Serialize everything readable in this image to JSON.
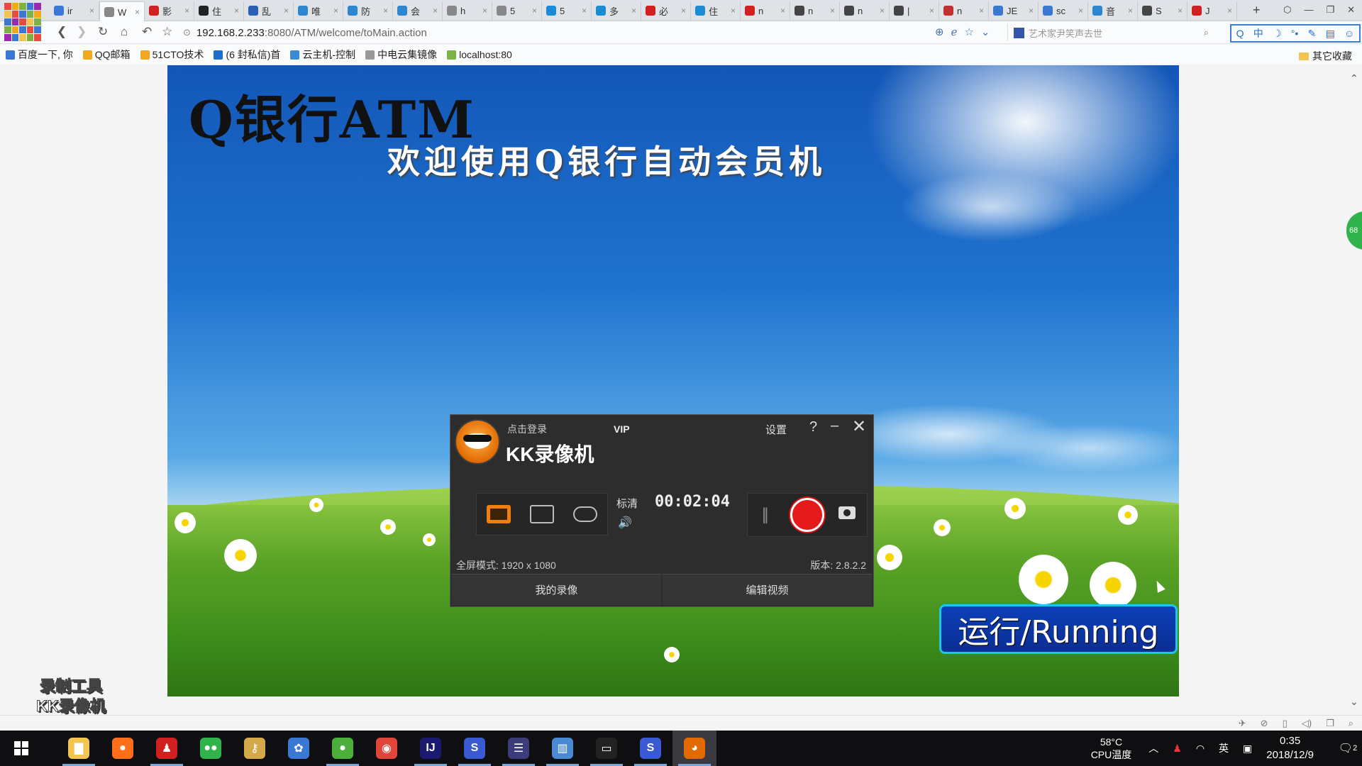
{
  "browser": {
    "tabs": [
      {
        "label": "ir",
        "icon_color": "#3a78d4",
        "active": false
      },
      {
        "label": "W",
        "icon_color": "#888888",
        "active": true
      },
      {
        "label": "影",
        "icon_color": "#d02020",
        "active": false
      },
      {
        "label": "住",
        "icon_color": "#222222",
        "active": false
      },
      {
        "label": "乱",
        "icon_color": "#2b5fb5",
        "active": false
      },
      {
        "label": "唯",
        "icon_color": "#2f86d0",
        "active": false
      },
      {
        "label": "防",
        "icon_color": "#2f86d0",
        "active": false
      },
      {
        "label": "会",
        "icon_color": "#2f86d0",
        "active": false
      },
      {
        "label": "h",
        "icon_color": "#888888",
        "active": false
      },
      {
        "label": "5",
        "icon_color": "#888888",
        "active": false
      },
      {
        "label": "5",
        "icon_color": "#1c8bd6",
        "active": false
      },
      {
        "label": "多",
        "icon_color": "#1c8bd6",
        "active": false
      },
      {
        "label": "必",
        "icon_color": "#d02020",
        "active": false
      },
      {
        "label": "住",
        "icon_color": "#1c8bd6",
        "active": false
      },
      {
        "label": "n",
        "icon_color": "#d02020",
        "active": false
      },
      {
        "label": "n",
        "icon_color": "#444444",
        "active": false
      },
      {
        "label": "n",
        "icon_color": "#444444",
        "active": false
      },
      {
        "label": "|",
        "icon_color": "#444444",
        "active": false
      },
      {
        "label": "n",
        "icon_color": "#c03030",
        "active": false
      },
      {
        "label": "JE",
        "icon_color": "#3a78d4",
        "active": false
      },
      {
        "label": "sc",
        "icon_color": "#3a78d4",
        "active": false
      },
      {
        "label": "音",
        "icon_color": "#2f86d0",
        "active": false
      },
      {
        "label": "S",
        "icon_color": "#444444",
        "active": false
      },
      {
        "label": "J",
        "icon_color": "#d02020",
        "active": false
      }
    ],
    "new_tab_label": "+",
    "url_host": "192.168.2.233",
    "url_rest": ":8080/ATM/welcome/toMain.action",
    "search_placeholder": "艺术家尹笑声去世",
    "ext_bar_items": [
      "Q",
      "中",
      "☽",
      "°•",
      "✎",
      "▤",
      "☺"
    ],
    "bookmarks": [
      {
        "label": "百度一下, 你",
        "icon_color": "#3a78d4"
      },
      {
        "label": "QQ邮箱",
        "icon_color": "#f2a81d"
      },
      {
        "label": "51CTO技术",
        "icon_color": "#f2a81d"
      },
      {
        "label": "(6 封私信)首",
        "icon_color": "#1c6fd0"
      },
      {
        "label": "云主机-控制",
        "icon_color": "#3a8ad4"
      },
      {
        "label": "中电云集镜像",
        "icon_color": "#999999"
      },
      {
        "label": "localhost:80",
        "icon_color": "#7cb342"
      }
    ],
    "other_bookmarks": "其它收藏"
  },
  "page": {
    "banner_title": "Q银行ATM",
    "banner_subtitle": "欢迎使用Q银行自动会员机",
    "running_button": "运行/Running",
    "float_ball_text": "68"
  },
  "watermark": {
    "line1": "录制工具",
    "line2": "KK录像机"
  },
  "kk_recorder": {
    "login_text": "点击登录",
    "vip_text": "VIP",
    "app_name": "KK录像机",
    "settings_label": "设置",
    "help_label": "?",
    "minimize_label": "–",
    "close_label": "✕",
    "quality": "标清",
    "volume_icon": "🔊",
    "timer": "00:02:04",
    "pause_label": "||",
    "mode_info": "全屏模式: 1920 x 1080",
    "version": "版本: 2.8.2.2",
    "my_recordings": "我的录像",
    "edit_video": "编辑视频"
  },
  "taskbar": {
    "apps": [
      {
        "name": "file-explorer",
        "glyph": "▇",
        "color": "#f2c550",
        "running": true
      },
      {
        "name": "firefox",
        "glyph": "●",
        "color": "#ff6f1a",
        "running": false
      },
      {
        "name": "qq",
        "glyph": "♟",
        "color": "#d02020",
        "running": true
      },
      {
        "name": "wechat",
        "glyph": "●●",
        "color": "#2fb34a",
        "running": false
      },
      {
        "name": "keys",
        "glyph": "⚷",
        "color": "#d4a94a",
        "running": false
      },
      {
        "name": "baidu-netdisk",
        "glyph": "✿",
        "color": "#3a78d4",
        "running": false
      },
      {
        "name": "360-browser",
        "glyph": "●",
        "color": "#4caf3a",
        "running": true
      },
      {
        "name": "chrome",
        "glyph": "◉",
        "color": "#e0453a",
        "running": false
      },
      {
        "name": "intellij",
        "glyph": "IJ",
        "color": "#1a1a70",
        "running": true
      },
      {
        "name": "eclipse-sts",
        "glyph": "S",
        "color": "#3a5ad4",
        "running": true
      },
      {
        "name": "eclipse",
        "glyph": "☰",
        "color": "#3c3c7a",
        "running": true
      },
      {
        "name": "winrar",
        "glyph": "▥",
        "color": "#4a8ad4",
        "running": true
      },
      {
        "name": "terminal",
        "glyph": "▭",
        "color": "#222222",
        "running": true
      },
      {
        "name": "sts-2",
        "glyph": "S",
        "color": "#3a5ad4",
        "running": true
      },
      {
        "name": "kk-recorder",
        "glyph": "◕",
        "color": "#e26a00",
        "running": true
      }
    ],
    "temp_value": "58°C",
    "temp_label": "CPU温度",
    "ime": "英",
    "time": "0:35",
    "date": "2018/12/9",
    "notification_count": "2"
  }
}
